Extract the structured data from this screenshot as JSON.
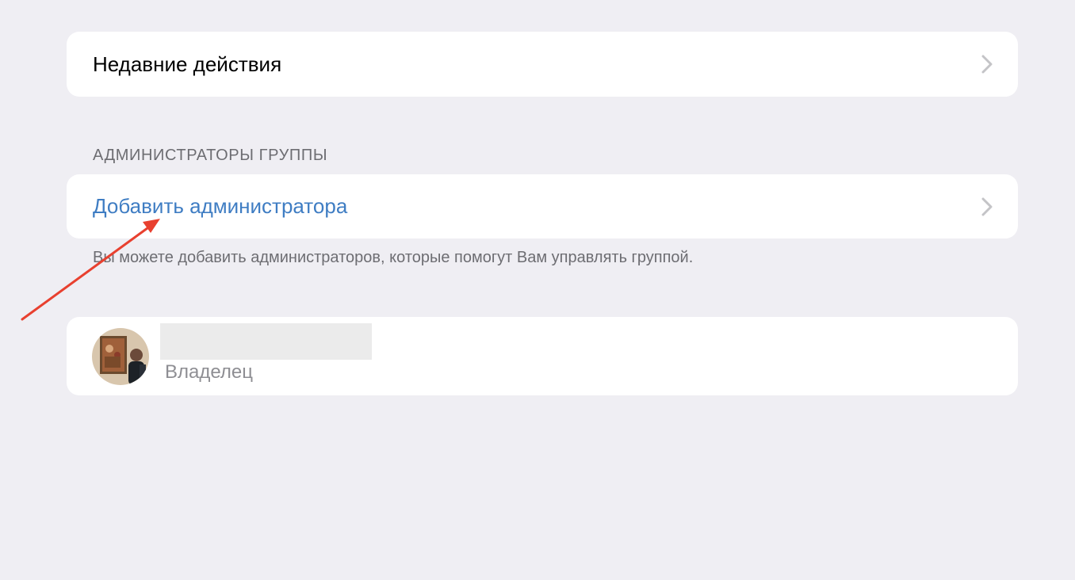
{
  "recent_actions": {
    "label": "Недавние действия",
    "icon": "chevron-right-icon"
  },
  "admins_section": {
    "header": "АДМИНИСТРАТОРЫ ГРУППЫ",
    "add_admin_label": "Добавить администратора",
    "footer_note": "Вы можете добавить администраторов, которые помогут Вам управлять группой."
  },
  "admin_list": [
    {
      "name": "",
      "role": "Владелец"
    }
  ],
  "colors": {
    "background": "#efeef3",
    "card": "#ffffff",
    "link": "#3f7dc3",
    "secondary_text": "#6d6d72",
    "annotation_arrow": "#e8402f"
  }
}
